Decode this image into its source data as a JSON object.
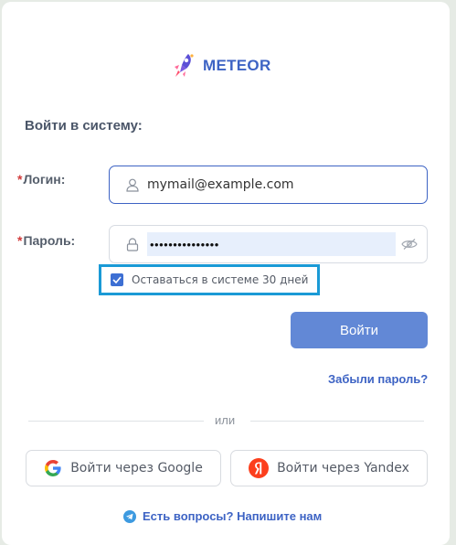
{
  "brand": {
    "name": "METEOR",
    "icon": "rocket-icon"
  },
  "heading": "Войти в систему:",
  "login": {
    "required_mark": "*",
    "label": "Логин:",
    "value": "mymail@example.com",
    "icon": "user-icon"
  },
  "password": {
    "required_mark": "*",
    "label": "Пароль:",
    "masked_value": "•••••••••••••••",
    "icon": "lock-icon",
    "toggle_icon": "eye-off-icon"
  },
  "remember": {
    "label": "Оставаться в системе 30 дней",
    "checked": true
  },
  "login_button": "Войти",
  "forgot_link": "Забыли пароль?",
  "divider": "или",
  "social": {
    "google": "Войти через Google",
    "yandex": "Войти через Yandex"
  },
  "help_link": "Есть вопросы? Напишите нам",
  "colors": {
    "accent": "#3d63c4",
    "button": "#6288d6",
    "highlight": "#1a9ad6",
    "required": "#d23b3b"
  }
}
